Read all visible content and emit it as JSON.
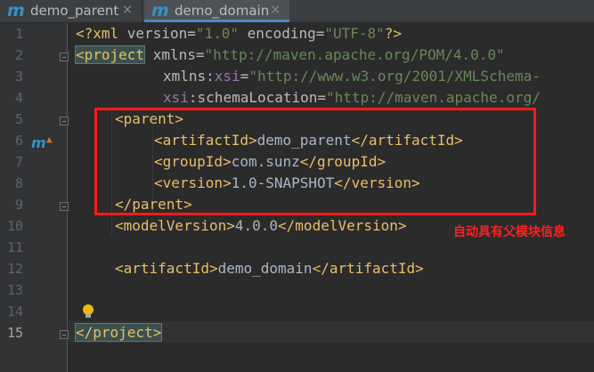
{
  "tabs": [
    {
      "icon": "m",
      "label": "demo_parent",
      "close": "×"
    },
    {
      "icon": "m",
      "label": "demo_domain",
      "close": "×"
    }
  ],
  "line_numbers": [
    "1",
    "2",
    "3",
    "4",
    "5",
    "6",
    "7",
    "8",
    "9",
    "10",
    "11",
    "12",
    "13",
    "14",
    "15"
  ],
  "code": {
    "l1": {
      "open": "<?xml ",
      "a1": "version=",
      "v1": "\"1.0\"",
      "a2": " encoding=",
      "v2": "\"UTF-8\"",
      "close": "?>"
    },
    "l2": {
      "tag": "<project",
      "attr": " xmlns=",
      "val": "\"http://maven.apache.org/POM/4.0.0\""
    },
    "l3": {
      "attr": "xmlns:",
      "ns": "xsi",
      "eq": "=",
      "val": "\"http://www.w3.org/2001/XMLSchema-"
    },
    "l4": {
      "ns": "xsi",
      "attr": ":schemaLocation=",
      "val": "\"http://maven.apache.org/"
    },
    "l5": {
      "tag": "<parent>"
    },
    "l6": {
      "open": "<artifactId>",
      "text": "demo_parent",
      "close": "</artifactId>"
    },
    "l7": {
      "open": "<groupId>",
      "text": "com.sunz",
      "close": "</groupId>"
    },
    "l8": {
      "open": "<version>",
      "text": "1.0-SNAPSHOT",
      "close": "</version>"
    },
    "l9": {
      "tag": "</parent>"
    },
    "l10": {
      "open": "<modelVersion>",
      "text": "4.0.0",
      "close": "</modelVersion>"
    },
    "l12": {
      "open": "<artifactId>",
      "text": "demo_domain",
      "close": "</artifactId>"
    },
    "l15": {
      "tag": "</project>"
    }
  },
  "annotation": {
    "note": "自动具有父模块信息",
    "color": "#ff1a1a"
  },
  "colors": {
    "tag": "#e8bf6a",
    "attr_value": "#6a8759",
    "namespace": "#9876aa",
    "text": "#a9b7c6",
    "background": "#2b2b2b",
    "accent": "#3592c4"
  },
  "icons": {
    "maven": "maven-m-icon",
    "bulb": "lightbulb-icon",
    "override": "go-to-parent-icon"
  }
}
